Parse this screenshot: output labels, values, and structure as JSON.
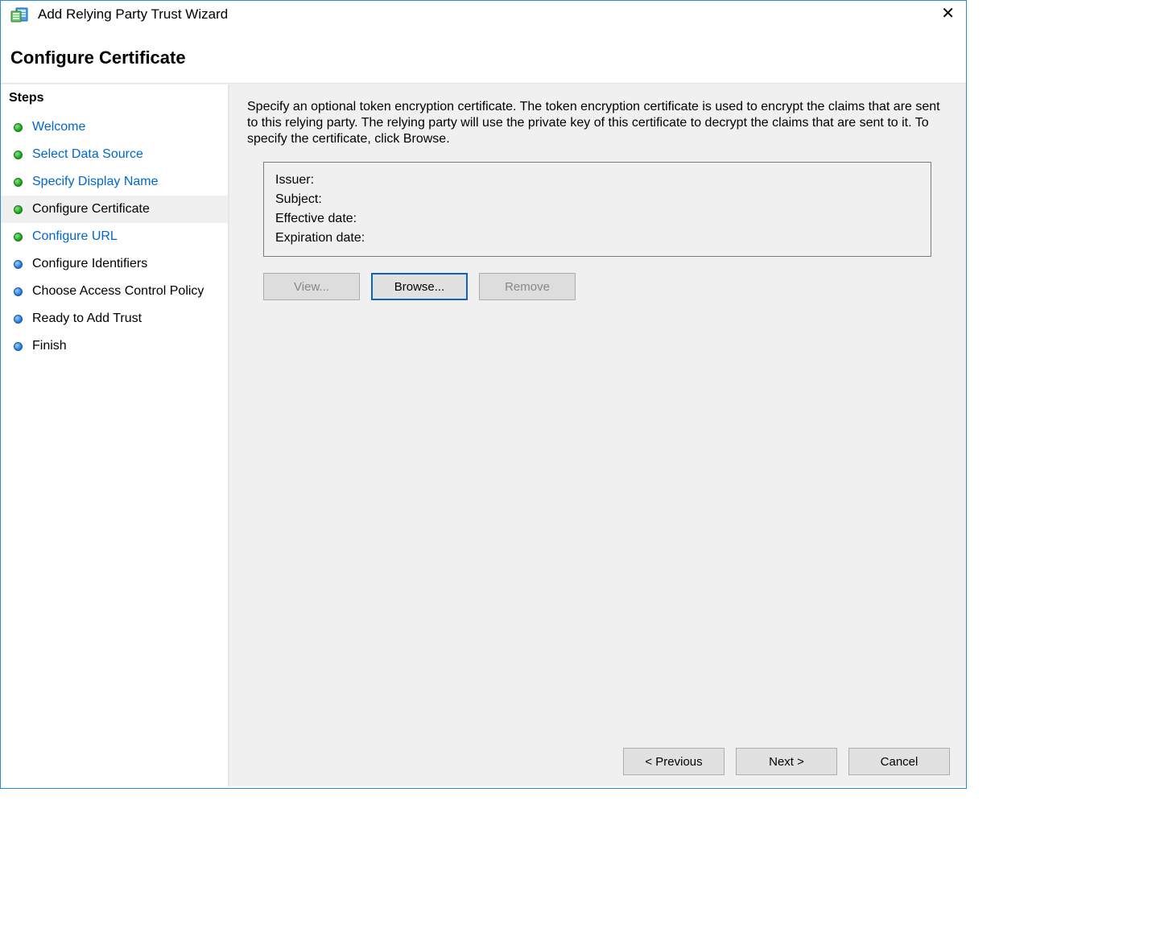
{
  "window": {
    "title": "Add Relying Party Trust Wizard"
  },
  "page": {
    "heading": "Configure Certificate",
    "instruction": "Specify an optional token encryption certificate.  The token encryption certificate is used to encrypt the claims that are sent to this relying party.  The relying party will use the private key of this certificate to decrypt the claims that are sent to it.  To specify the certificate, click Browse."
  },
  "sidebar": {
    "heading": "Steps",
    "steps": [
      {
        "label": "Welcome",
        "color": "green",
        "link": true,
        "current": false
      },
      {
        "label": "Select Data Source",
        "color": "green",
        "link": true,
        "current": false
      },
      {
        "label": "Specify Display Name",
        "color": "green",
        "link": true,
        "current": false
      },
      {
        "label": "Configure Certificate",
        "color": "green",
        "link": false,
        "current": true
      },
      {
        "label": "Configure URL",
        "color": "green",
        "link": true,
        "current": false
      },
      {
        "label": "Configure Identifiers",
        "color": "blue",
        "link": false,
        "current": false
      },
      {
        "label": "Choose Access Control Policy",
        "color": "blue",
        "link": false,
        "current": false
      },
      {
        "label": "Ready to Add Trust",
        "color": "blue",
        "link": false,
        "current": false
      },
      {
        "label": "Finish",
        "color": "blue",
        "link": false,
        "current": false
      }
    ]
  },
  "cert": {
    "issuer_label": "Issuer:",
    "issuer_value": "",
    "subject_label": "Subject:",
    "subject_value": "",
    "effective_label": "Effective date:",
    "effective_value": "",
    "expiration_label": "Expiration date:",
    "expiration_value": ""
  },
  "buttons": {
    "view": "View...",
    "browse": "Browse...",
    "remove": "Remove",
    "previous": "< Previous",
    "next": "Next >",
    "cancel": "Cancel"
  }
}
